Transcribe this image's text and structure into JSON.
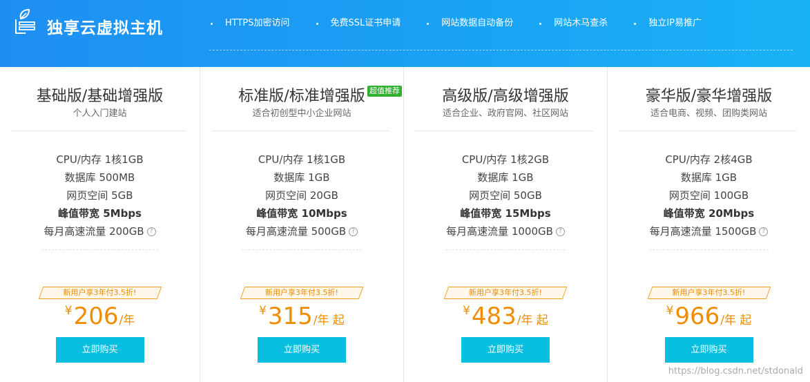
{
  "header": {
    "brand_title": "独享云虚拟主机",
    "logo_icon": "server-leaf-icon",
    "features": [
      "HTTPS加密访问",
      "免费SSL证书申请",
      "网站数据自动备份",
      "网站木马查杀",
      "独立IP易推广"
    ]
  },
  "plans": [
    {
      "name": "基础版/基础增强版",
      "subtitle": "个人入门建站",
      "badge": "",
      "specs": [
        "CPU/内存 1核1GB",
        "数据库 500MB",
        "网页空间 5GB",
        "峰值带宽 5Mbps",
        "每月高速流量 200GB"
      ],
      "promo": "新用户享3年付3.5折!",
      "currency": "¥",
      "price": "206",
      "unit": "/年",
      "button": "立即购买"
    },
    {
      "name": "标准版/标准增强版",
      "subtitle": "适合初创型中小企业网站",
      "badge": "超值推荐",
      "specs": [
        "CPU/内存 1核1GB",
        "数据库 1GB",
        "网页空间 20GB",
        "峰值带宽 10Mbps",
        "每月高速流量 500GB"
      ],
      "promo": "新用户享3年付3.5折!",
      "currency": "¥",
      "price": "315",
      "unit": "/年 起",
      "button": "立即购买"
    },
    {
      "name": "高级版/高级增强版",
      "subtitle": "适合企业、政府官网、社区网站",
      "badge": "",
      "specs": [
        "CPU/内存 1核2GB",
        "数据库 1GB",
        "网页空间 50GB",
        "峰值带宽 15Mbps",
        "每月高速流量 1000GB"
      ],
      "promo": "新用户享3年付3.5折!",
      "currency": "¥",
      "price": "483",
      "unit": "/年 起",
      "button": "立即购买"
    },
    {
      "name": "豪华版/豪华增强版",
      "subtitle": "适合电商、视频、团购类网站",
      "badge": "",
      "specs": [
        "CPU/内存 2核4GB",
        "数据库 1GB",
        "网页空间 100GB",
        "峰值带宽 20Mbps",
        "每月高速流量 1500GB"
      ],
      "promo": "新用户享3年付3.5折!",
      "currency": "¥",
      "price": "966",
      "unit": "/年 起",
      "button": "立即购买"
    }
  ],
  "help_icon_glyph": "?",
  "watermark": "https://blog.csdn.net/stdonald",
  "colors": {
    "banner_start": "#1e8ff2",
    "banner_end": "#1ab2f6",
    "price": "#f08c00",
    "button": "#08bfe0",
    "badge": "#2fb12f"
  }
}
